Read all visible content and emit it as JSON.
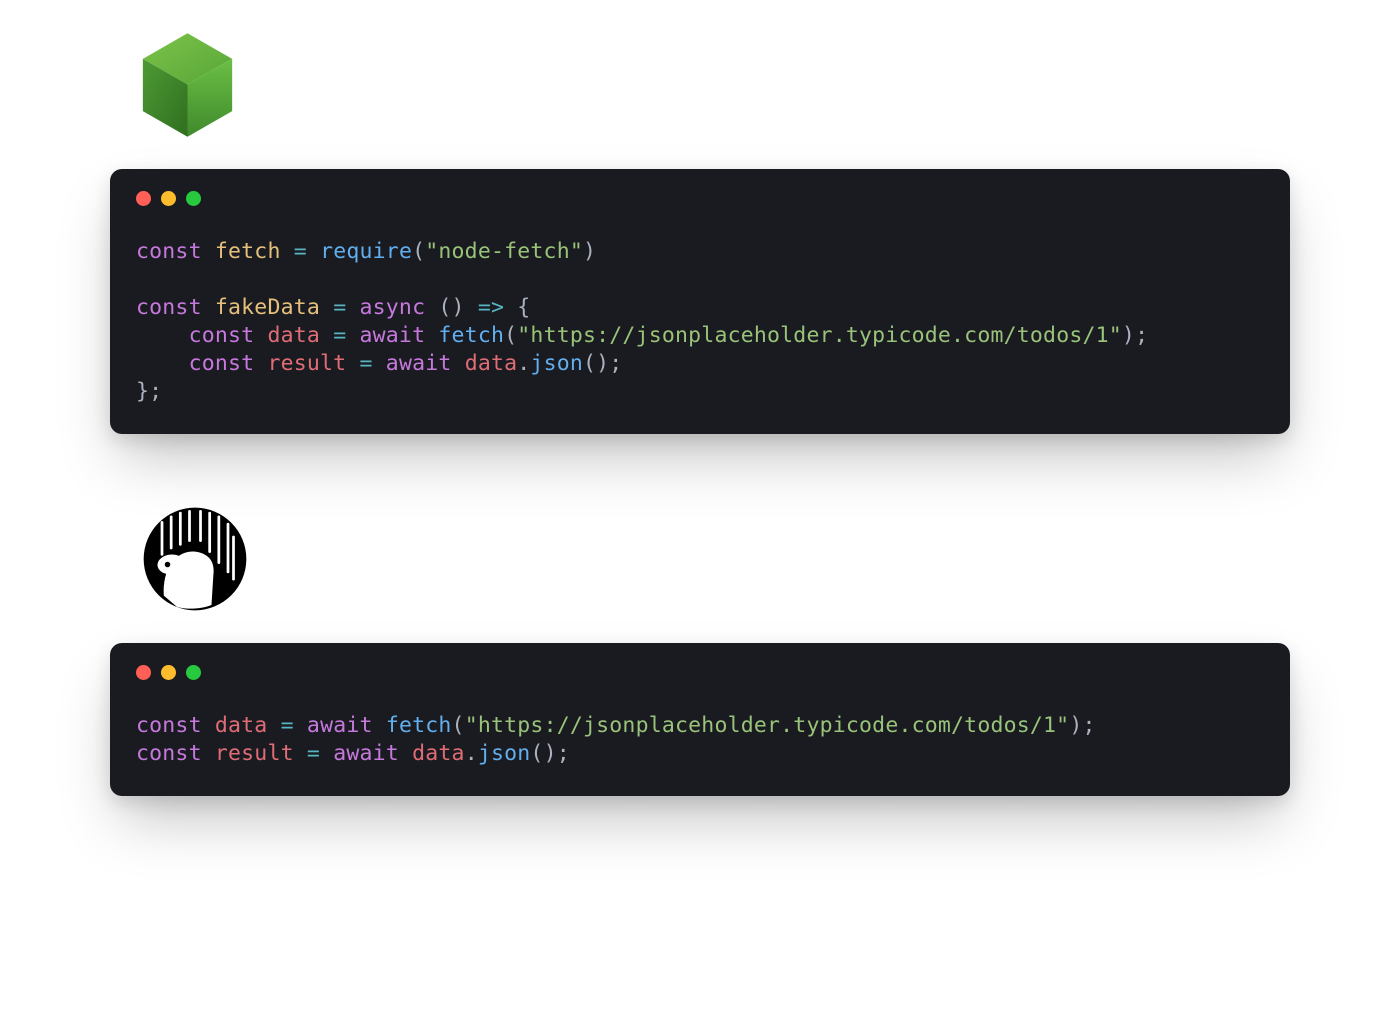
{
  "syntax_colors": {
    "keyword": "#c678dd",
    "identifier": "#e5c07b",
    "variable": "#e06c75",
    "function": "#61afef",
    "string": "#98c379",
    "punctuation": "#abb2bf",
    "operator": "#56b6c2",
    "background": "#1a1b21"
  },
  "traffic_light_colors": {
    "red": "#ff5f56",
    "yellow": "#ffbd2e",
    "green": "#27c93f"
  },
  "blocks": [
    {
      "runtime": "node",
      "logo": "node-hex-icon",
      "code": [
        [
          {
            "t": "const ",
            "c": "kw"
          },
          {
            "t": "fetch",
            "c": "ident"
          },
          {
            "t": " ",
            "c": "punct"
          },
          {
            "t": "=",
            "c": "op"
          },
          {
            "t": " ",
            "c": "punct"
          },
          {
            "t": "require",
            "c": "fn"
          },
          {
            "t": "(",
            "c": "punct"
          },
          {
            "t": "\"node-fetch\"",
            "c": "str"
          },
          {
            "t": ")",
            "c": "punct"
          }
        ],
        [],
        [
          {
            "t": "const ",
            "c": "kw"
          },
          {
            "t": "fakeData",
            "c": "ident"
          },
          {
            "t": " ",
            "c": "punct"
          },
          {
            "t": "=",
            "c": "op"
          },
          {
            "t": " ",
            "c": "punct"
          },
          {
            "t": "async",
            "c": "kw"
          },
          {
            "t": " ",
            "c": "punct"
          },
          {
            "t": "()",
            "c": "punct"
          },
          {
            "t": " ",
            "c": "punct"
          },
          {
            "t": "=>",
            "c": "op"
          },
          {
            "t": " ",
            "c": "punct"
          },
          {
            "t": "{",
            "c": "punct"
          }
        ],
        [
          {
            "t": "    ",
            "c": "punct"
          },
          {
            "t": "const ",
            "c": "kw"
          },
          {
            "t": "data",
            "c": "var"
          },
          {
            "t": " ",
            "c": "punct"
          },
          {
            "t": "=",
            "c": "op"
          },
          {
            "t": " ",
            "c": "punct"
          },
          {
            "t": "await",
            "c": "kw"
          },
          {
            "t": " ",
            "c": "punct"
          },
          {
            "t": "fetch",
            "c": "fn"
          },
          {
            "t": "(",
            "c": "punct"
          },
          {
            "t": "\"https://jsonplaceholder.typicode.com/todos/1\"",
            "c": "str"
          },
          {
            "t": ");",
            "c": "punct"
          }
        ],
        [
          {
            "t": "    ",
            "c": "punct"
          },
          {
            "t": "const ",
            "c": "kw"
          },
          {
            "t": "result",
            "c": "var"
          },
          {
            "t": " ",
            "c": "punct"
          },
          {
            "t": "=",
            "c": "op"
          },
          {
            "t": " ",
            "c": "punct"
          },
          {
            "t": "await",
            "c": "kw"
          },
          {
            "t": " ",
            "c": "punct"
          },
          {
            "t": "data",
            "c": "var"
          },
          {
            "t": ".",
            "c": "punct"
          },
          {
            "t": "json",
            "c": "fn"
          },
          {
            "t": "();",
            "c": "punct"
          }
        ],
        [
          {
            "t": "};",
            "c": "punct"
          }
        ]
      ]
    },
    {
      "runtime": "deno",
      "logo": "deno-circle-icon",
      "code": [
        [
          {
            "t": "const ",
            "c": "kw"
          },
          {
            "t": "data",
            "c": "var"
          },
          {
            "t": " ",
            "c": "punct"
          },
          {
            "t": "=",
            "c": "op"
          },
          {
            "t": " ",
            "c": "punct"
          },
          {
            "t": "await",
            "c": "kw"
          },
          {
            "t": " ",
            "c": "punct"
          },
          {
            "t": "fetch",
            "c": "fn"
          },
          {
            "t": "(",
            "c": "punct"
          },
          {
            "t": "\"https://jsonplaceholder.typicode.com/todos/1\"",
            "c": "str"
          },
          {
            "t": ");",
            "c": "punct"
          }
        ],
        [
          {
            "t": "const ",
            "c": "kw"
          },
          {
            "t": "result",
            "c": "var"
          },
          {
            "t": " ",
            "c": "punct"
          },
          {
            "t": "=",
            "c": "op"
          },
          {
            "t": " ",
            "c": "punct"
          },
          {
            "t": "await",
            "c": "kw"
          },
          {
            "t": " ",
            "c": "punct"
          },
          {
            "t": "data",
            "c": "var"
          },
          {
            "t": ".",
            "c": "punct"
          },
          {
            "t": "json",
            "c": "fn"
          },
          {
            "t": "();",
            "c": "punct"
          }
        ]
      ]
    }
  ]
}
